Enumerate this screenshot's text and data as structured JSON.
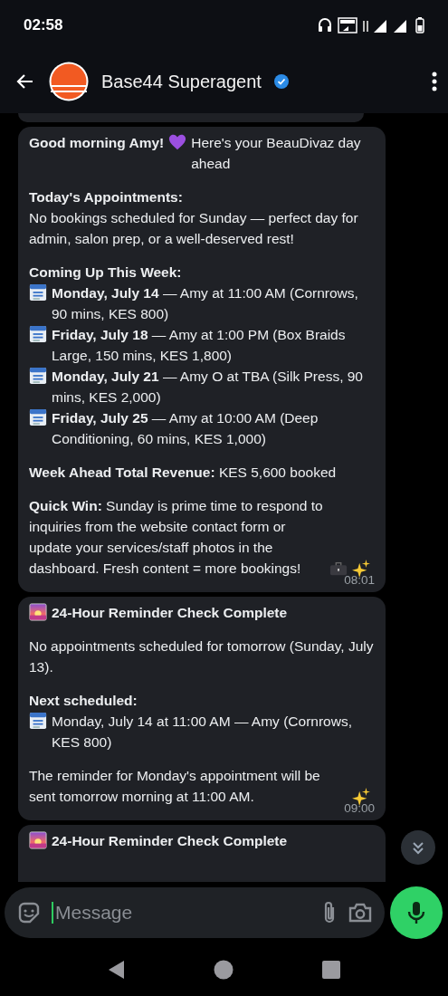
{
  "status_bar": {
    "time": "02:58"
  },
  "header": {
    "title": "Base44 Superagent",
    "verified": true
  },
  "messages": [
    {
      "blocks": [
        [
          {
            "segments": [
              {
                "kind": "heading",
                "text": "Good morning Amy!"
              },
              {
                "kind": "heart"
              },
              {
                "kind": "text",
                "text": "Here's your BeauDivaz day ahead"
              }
            ]
          }
        ],
        [
          {
            "segments": [
              {
                "kind": "heading",
                "text": "Today's Appointments:"
              }
            ]
          },
          {
            "segments": [
              {
                "kind": "text",
                "text": "No bookings scheduled for Sunday — perfect day for admin, salon prep, or a well-deserved rest!"
              }
            ]
          }
        ],
        [
          {
            "segments": [
              {
                "kind": "heading",
                "text": "Coming Up This Week:"
              }
            ]
          },
          {
            "segments": [
              {
                "kind": "calendar"
              },
              {
                "kind": "text",
                "text": "**Monday, July 14** — Amy at 11:00 AM (Cornrows, 90 mins, KES 800)"
              }
            ]
          },
          {
            "segments": [
              {
                "kind": "calendar"
              },
              {
                "kind": "text",
                "text": "**Friday, July 18** — Amy at 1:00 PM (Box Braids Large, 150 mins, KES 1,800)"
              }
            ]
          },
          {
            "segments": [
              {
                "kind": "calendar"
              },
              {
                "kind": "text",
                "text": "**Monday, July 21** — Amy O at TBA (Silk Press, 90 mins, KES 2,000)"
              }
            ]
          },
          {
            "segments": [
              {
                "kind": "calendar"
              },
              {
                "kind": "text",
                "text": "**Friday, July 25** — Amy at 10:00 AM (Deep Conditioning, 60 mins, KES 1,000)"
              }
            ]
          }
        ],
        [
          {
            "segments": [
              {
                "kind": "text",
                "text": "**Week Ahead Total Revenue:** KES 5,600 booked"
              }
            ]
          }
        ],
        [
          {
            "segments": [
              {
                "kind": "text",
                "text": "**Quick Win:** Sunday is prime time to respond to inquiries from the website contact form or update your services/staff photos in the dashboard. Fresh content = more bookings!"
              },
              {
                "kind": "briefcase"
              },
              {
                "kind": "sparkles"
              }
            ]
          }
        ]
      ],
      "time": "08:01"
    },
    {
      "blocks": [
        [
          {
            "segments": [
              {
                "kind": "sunrise"
              },
              {
                "kind": "heading",
                "text": "24-Hour Reminder Check Complete"
              }
            ]
          }
        ],
        [
          {
            "segments": [
              {
                "kind": "text",
                "text": "No appointments scheduled for tomorrow (Sunday, July 13)."
              }
            ]
          }
        ],
        [
          {
            "segments": [
              {
                "kind": "heading",
                "text": "Next scheduled:"
              }
            ]
          },
          {
            "segments": [
              {
                "kind": "calendar"
              },
              {
                "kind": "text",
                "text": "Monday, July 14 at 11:00 AM — Amy (Cornrows, KES 800)"
              }
            ]
          }
        ],
        [
          {
            "segments": [
              {
                "kind": "text",
                "text": "The reminder for Monday's appointment will be sent tomorrow morning at 11:00 AM."
              },
              {
                "kind": "sparkles"
              }
            ]
          }
        ]
      ],
      "time": "09:00"
    },
    {
      "blocks": [
        [
          {
            "segments": [
              {
                "kind": "sunrise"
              },
              {
                "kind": "heading",
                "text": "24-Hour Reminder Check Complete"
              }
            ]
          }
        ]
      ]
    }
  ],
  "composer": {
    "placeholder": "Message"
  }
}
